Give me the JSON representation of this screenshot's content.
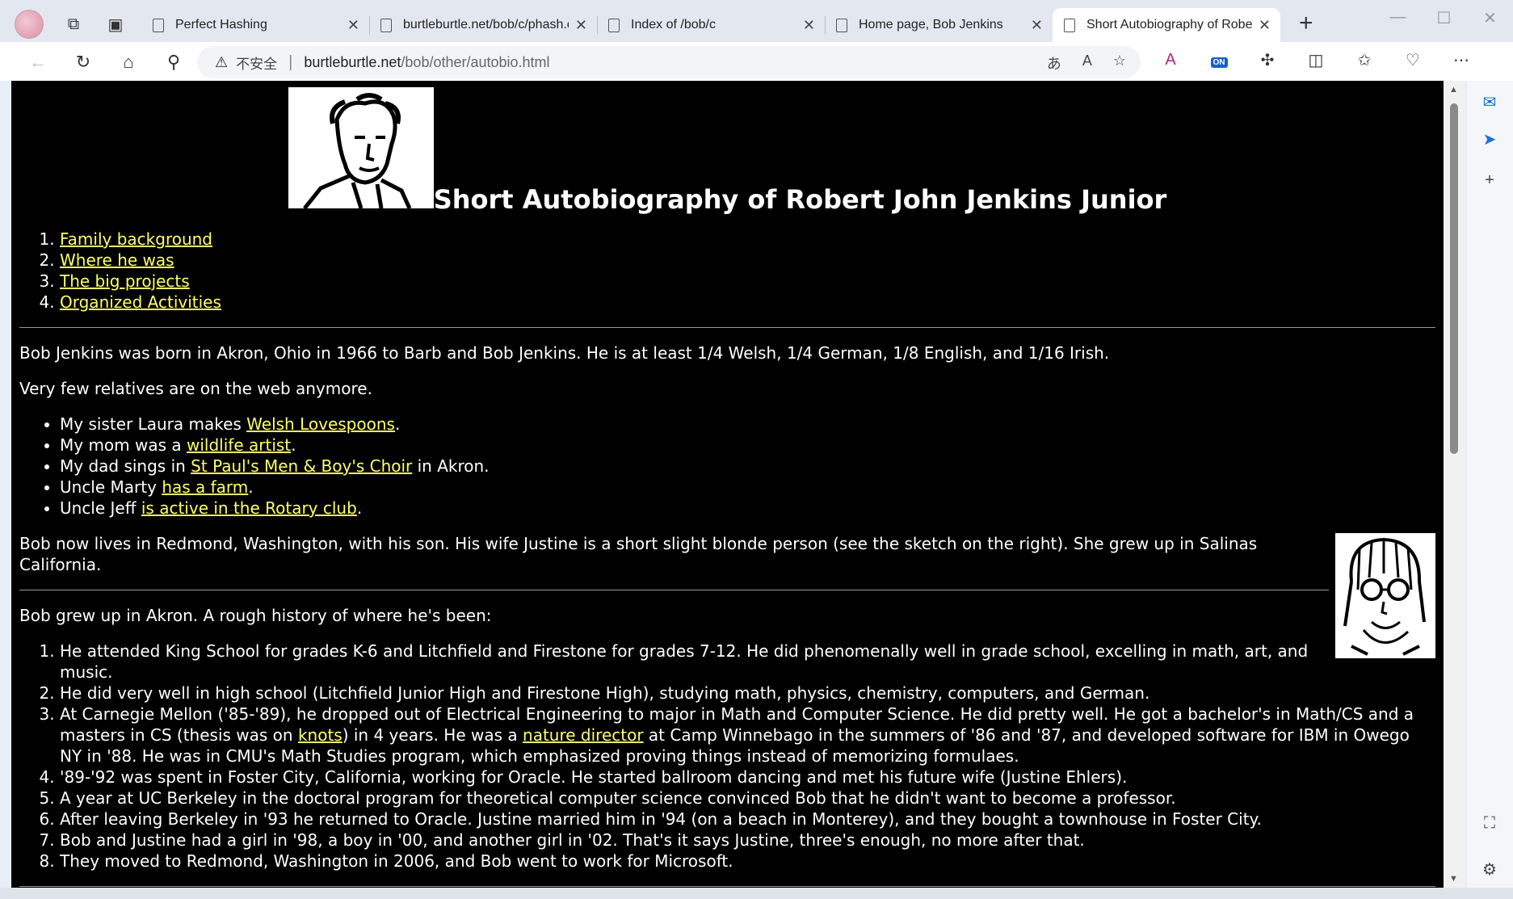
{
  "tabs": [
    {
      "label": "Perfect Hashing",
      "active": false
    },
    {
      "label": "burtleburtle.net/bob/c/phash.c",
      "active": false
    },
    {
      "label": "Index of /bob/c",
      "active": false
    },
    {
      "label": "Home page, Bob Jenkins",
      "active": false
    },
    {
      "label": "Short Autobiography of Robert",
      "active": true
    }
  ],
  "address": {
    "security_label": "不安全",
    "host": "burtleburtle.net",
    "path": "/bob/other/autobio.html"
  },
  "toolbar": {
    "extension_badge": "ON"
  },
  "page": {
    "title": "Short Autobiography of Robert John Jenkins Junior",
    "toc": [
      "Family background",
      "Where he was",
      "The big projects",
      "Organized Activities"
    ],
    "family": {
      "p1": "Bob Jenkins was born in Akron, Ohio in 1966 to Barb and Bob Jenkins. He is at least 1/4 Welsh, 1/4 German, 1/8 English, and 1/16 Irish.",
      "p2": "Very few relatives are on the web anymore.",
      "relatives": [
        {
          "before": "My sister Laura makes ",
          "link": "Welsh Lovespoons",
          "after": "."
        },
        {
          "before": "My mom was a ",
          "link": "wildlife artist",
          "after": "."
        },
        {
          "before": "My dad sings in ",
          "link": "St Paul's Men & Boy's Choir",
          "after": " in Akron."
        },
        {
          "before": "Uncle Marty ",
          "link": "has a farm",
          "after": "."
        },
        {
          "before": "Uncle Jeff ",
          "link": "is active in the Rotary club",
          "after": "."
        }
      ],
      "p3": "Bob now lives in Redmond, Washington, with his son. His wife Justine is a short slight blonde person (see the sketch on the right). She grew up in Salinas California."
    },
    "where": {
      "intro": "Bob grew up in Akron. A rough history of where he's been:",
      "item1": "He attended King School for grades K-6 and Litchfield and Firestone for grades 7-12. He did phenomenally well in grade school, excelling in math, art, and music.",
      "item2": "He did very well in high school (Litchfield Junior High and Firestone High), studying math, physics, chemistry, computers, and German.",
      "item3_a": "At Carnegie Mellon ('85-'89), he dropped out of Electrical Engineering to major in Math and Computer Science. He did pretty well. He got a bachelor's in Math/CS and a masters in CS (thesis was on ",
      "item3_link1": "knots",
      "item3_b": ") in 4 years. He was a ",
      "item3_link2": "nature director",
      "item3_c": " at Camp Winnebago in the summers of '86 and '87, and developed software for IBM in Owego NY in '88. He was in CMU's Math Studies program, which emphasized proving things instead of memorizing formulaes.",
      "item4": "'89-'92 was spent in Foster City, California, working for Oracle. He started ballroom dancing and met his future wife (Justine Ehlers).",
      "item5": "A year at UC Berkeley in the doctoral program for theoretical computer science convinced Bob that he didn't want to become a professor.",
      "item6": "After leaving Berkeley in '93 he returned to Oracle. Justine married him in '94 (on a beach in Monterey), and they bought a townhouse in Foster City.",
      "item7": "Bob and Justine had a girl in '98, a boy in '00, and another girl in '02. That's it says Justine, three's enough, no more after that.",
      "item8": "They moved to Redmond, Washington in 2006, and Bob went to work for Microsoft."
    }
  }
}
